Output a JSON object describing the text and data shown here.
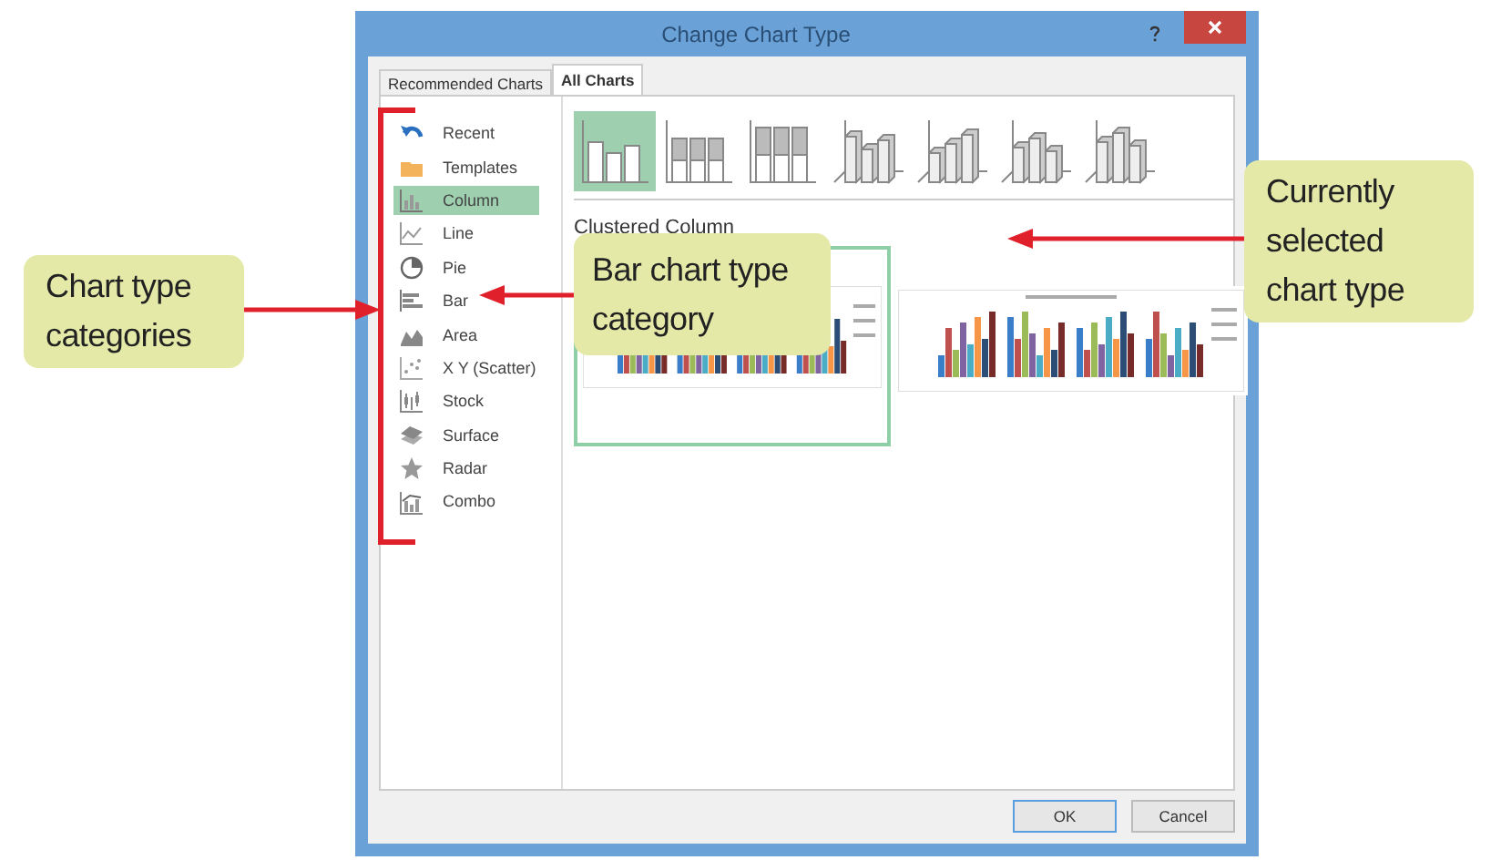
{
  "window": {
    "title": "Change Chart Type"
  },
  "tabs": [
    {
      "label": "Recommended Charts",
      "selected": false
    },
    {
      "label": "All Charts",
      "selected": true
    }
  ],
  "categories": [
    {
      "label": "Recent",
      "selected": false
    },
    {
      "label": "Templates",
      "selected": false
    },
    {
      "label": "Column",
      "selected": true
    },
    {
      "label": "Line",
      "selected": false
    },
    {
      "label": "Pie",
      "selected": false
    },
    {
      "label": "Bar",
      "selected": false
    },
    {
      "label": "Area",
      "selected": false
    },
    {
      "label": "X Y (Scatter)",
      "selected": false
    },
    {
      "label": "Stock",
      "selected": false
    },
    {
      "label": "Surface",
      "selected": false
    },
    {
      "label": "Radar",
      "selected": false
    },
    {
      "label": "Combo",
      "selected": false
    }
  ],
  "subtypes": [
    {
      "kind": "flat",
      "selected": true
    },
    {
      "kind": "flat",
      "selected": false
    },
    {
      "kind": "flat",
      "selected": false
    },
    {
      "kind": "depth",
      "selected": false
    },
    {
      "kind": "depth",
      "selected": false
    },
    {
      "kind": "depth",
      "selected": false
    },
    {
      "kind": "depth",
      "selected": false
    }
  ],
  "subtype_title": "Clustered Column",
  "previews": [
    {
      "selected": true
    },
    {
      "selected": false
    }
  ],
  "buttons": [
    {
      "label": "OK",
      "kind": "default"
    },
    {
      "label": "Cancel",
      "kind": "normal"
    }
  ],
  "callouts": [
    {
      "text": "Chart type categories"
    },
    {
      "text": "Bar chart type category"
    },
    {
      "text": "Currently selected chart type"
    }
  ]
}
